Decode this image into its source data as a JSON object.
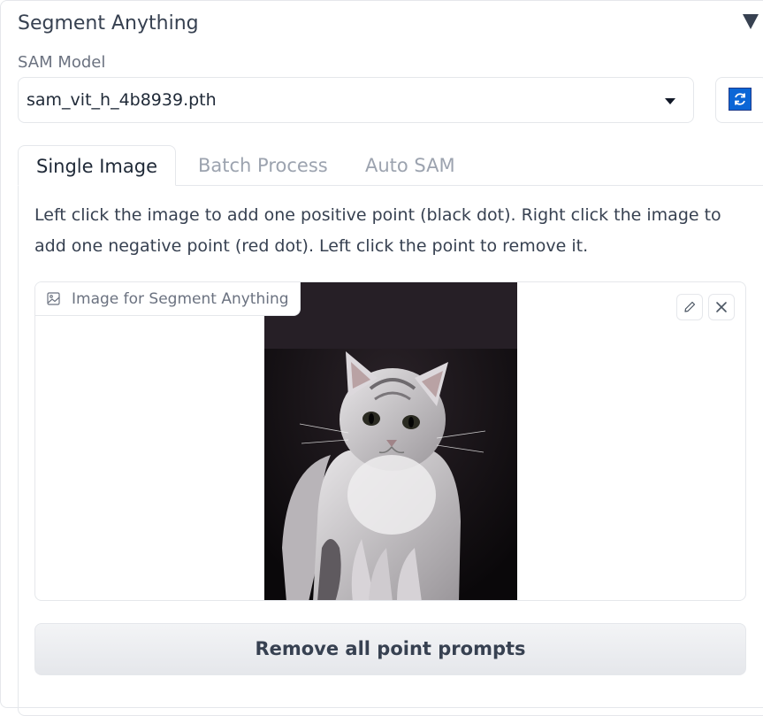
{
  "accordion": {
    "title": "Segment Anything",
    "toggle_icon": "triangle-down-icon"
  },
  "sam_model": {
    "label": "SAM Model",
    "selected": "sam_vit_h_4b8939.pth",
    "refresh_icon": "refresh-icon"
  },
  "tabs": [
    {
      "label": "Single Image",
      "active": true
    },
    {
      "label": "Batch Process",
      "active": false
    },
    {
      "label": "Auto SAM",
      "active": false
    }
  ],
  "single_image": {
    "instructions": "Left click the image to add one positive point (black dot). Right click the image to add one negative point (red dot). Left click the point to remove it.",
    "image_component": {
      "label": "Image for Segment Anything",
      "label_icon": "image-icon",
      "edit_icon": "pencil-icon",
      "clear_icon": "close-icon",
      "content": "photo of a grey and white tabby cat sitting against a dark background"
    },
    "remove_button_label": "Remove all point prompts"
  },
  "colors": {
    "accent": "#0b66d6",
    "border": "#e5e7eb",
    "text": "#1f2937",
    "muted_text": "#9ca3af"
  }
}
